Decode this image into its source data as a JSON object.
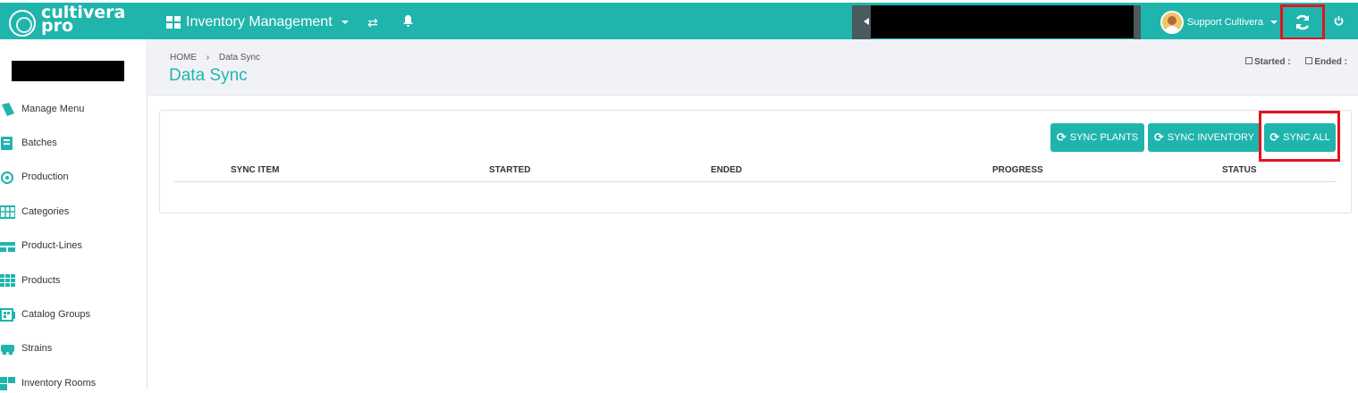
{
  "logo": {
    "line1": "cultivera",
    "line2": "pro"
  },
  "topbar": {
    "app_label": "Inventory Management",
    "swap_icon": "swap-icon",
    "bell_icon": "bell-icon",
    "user_name": "Support Cultivera",
    "sync_icon": "sync-icon",
    "power_icon": "power-icon"
  },
  "sidebar": {
    "items": [
      {
        "label": "Manage Menu",
        "icon": "menu-book-icon"
      },
      {
        "label": "Batches",
        "icon": "batches-icon"
      },
      {
        "label": "Production",
        "icon": "production-icon"
      },
      {
        "label": "Categories",
        "icon": "categories-icon"
      },
      {
        "label": "Product-Lines",
        "icon": "product-lines-icon"
      },
      {
        "label": "Products",
        "icon": "products-icon"
      },
      {
        "label": "Catalog Groups",
        "icon": "catalog-groups-icon"
      },
      {
        "label": "Strains",
        "icon": "strains-icon"
      },
      {
        "label": "Inventory Rooms",
        "icon": "inventory-rooms-icon"
      }
    ]
  },
  "header": {
    "breadcrumb_home": "HOME",
    "breadcrumb_current": "Data Sync",
    "title": "Data Sync",
    "started_label": "Started :",
    "ended_label": "Ended :"
  },
  "actions": {
    "sync_plants": "SYNC PLANTS",
    "sync_inventory": "SYNC INVENTORY",
    "sync_all": "SYNC ALL"
  },
  "table": {
    "columns": [
      "SYNC ITEM",
      "STARTED",
      "ENDED",
      "PROGRESS",
      "STATUS"
    ],
    "rows": []
  },
  "colors": {
    "accent": "#1fb5ad",
    "highlight": "#e0141e"
  }
}
